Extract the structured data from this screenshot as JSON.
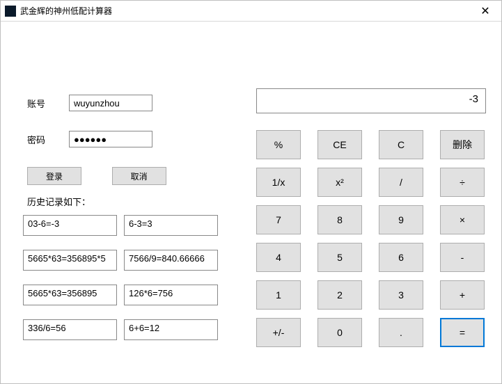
{
  "window": {
    "title": "武金辉的神州低配计算器",
    "close_glyph": "✕"
  },
  "login": {
    "account_label": "账号",
    "account_value": "wuyunzhou",
    "password_label": "密码",
    "password_value": "●●●●●●",
    "login_btn": "登录",
    "cancel_btn": "取消"
  },
  "history": {
    "title": "历史记录如下：",
    "items": [
      "03-6=-3",
      "6-3=3",
      "5665*63=356895*5",
      "7566/9=840.66666",
      "5665*63=356895",
      "126*6=756",
      "336/6=56",
      "6+6=12"
    ]
  },
  "calculator": {
    "display": "-3",
    "keys": [
      "%",
      "CE",
      "C",
      "删除",
      "1/x",
      "x²",
      "/",
      "÷",
      "7",
      "8",
      "9",
      "×",
      "4",
      "5",
      "6",
      "-",
      "1",
      "2",
      "3",
      "+",
      "+/-",
      "0",
      ".",
      "="
    ],
    "key_names": [
      "percent",
      "clear-entry",
      "clear",
      "delete",
      "reciprocal",
      "square",
      "slash",
      "divide",
      "seven",
      "eight",
      "nine",
      "multiply",
      "four",
      "five",
      "six",
      "subtract",
      "one",
      "two",
      "three",
      "add",
      "negate",
      "zero",
      "decimal",
      "equals"
    ],
    "focused_key_index": 23
  }
}
